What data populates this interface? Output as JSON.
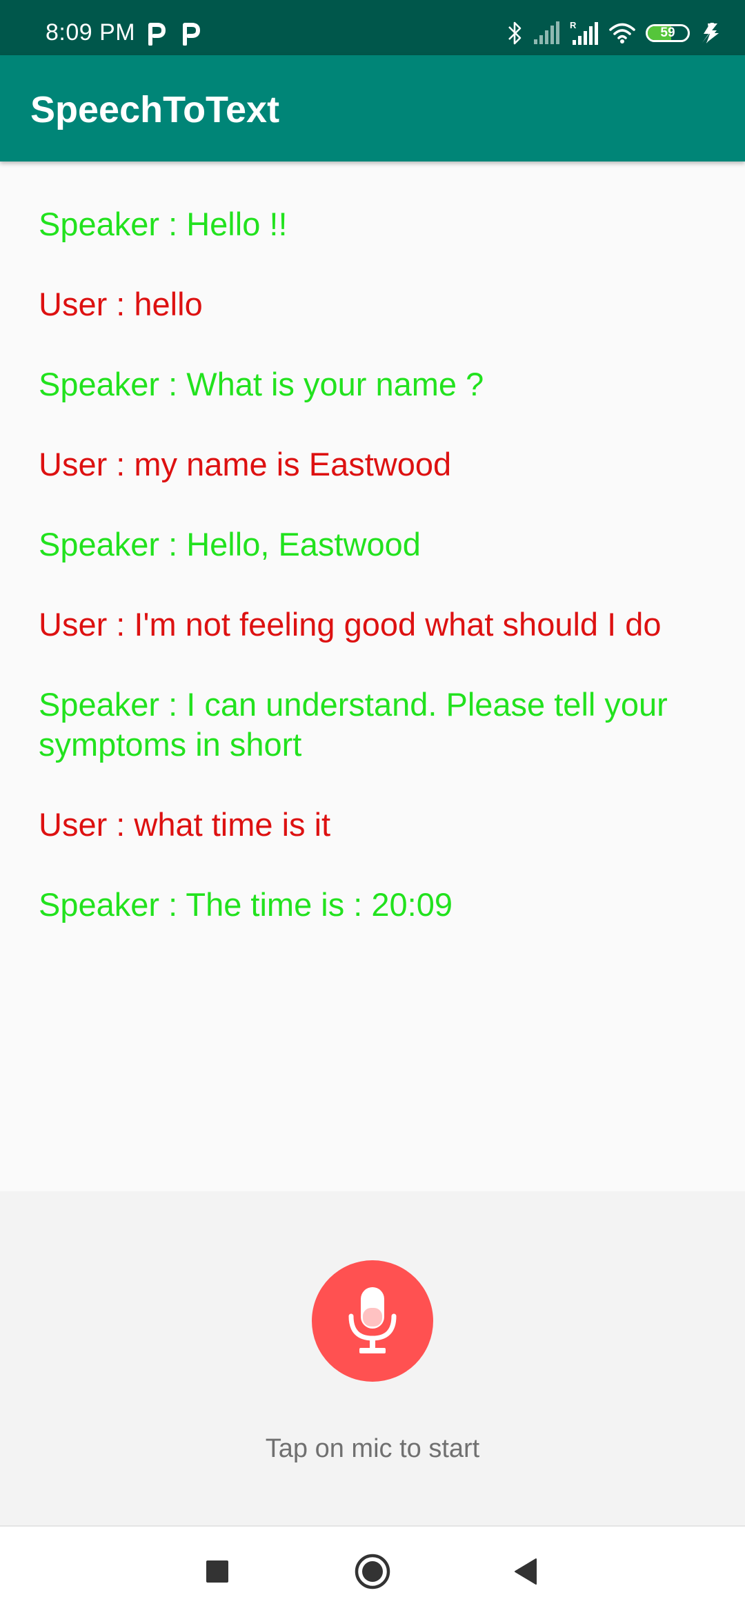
{
  "status_bar": {
    "time": "8:09 PM",
    "battery_level": "59",
    "battery_fraction": 0.59,
    "icons": [
      "p-notification-icon",
      "p-notification-icon",
      "bluetooth-icon",
      "signal-icon",
      "roaming-signal-icon",
      "wifi-icon",
      "battery-icon",
      "charging-icon"
    ]
  },
  "app_bar": {
    "title": "SpeechToText"
  },
  "conversation": {
    "messages": [
      {
        "role": "speaker",
        "text": "Speaker : Hello !!"
      },
      {
        "role": "user",
        "text": "User : hello"
      },
      {
        "role": "speaker",
        "text": "Speaker : What is your name ?"
      },
      {
        "role": "user",
        "text": "User : my name is Eastwood"
      },
      {
        "role": "speaker",
        "text": "Speaker : Hello, Eastwood"
      },
      {
        "role": "user",
        "text": "User : I'm not feeling good what should I do"
      },
      {
        "role": "speaker",
        "text": "Speaker : I can understand. Please tell your symptoms in short"
      },
      {
        "role": "user",
        "text": "User : what time is it"
      },
      {
        "role": "speaker",
        "text": "Speaker : The time is : 20:09"
      }
    ]
  },
  "mic": {
    "icon": "microphone-icon",
    "hint": "Tap on mic to start"
  },
  "nav_bar": {
    "icons": [
      "recents-square-icon",
      "home-circle-icon",
      "back-triangle-icon"
    ]
  },
  "colors": {
    "status_bar": "#00574b",
    "app_bar": "#008577",
    "speaker_text": "#22e21e",
    "user_text": "#dd1111",
    "mic_button": "#ff5151",
    "hint_text": "#707070"
  }
}
